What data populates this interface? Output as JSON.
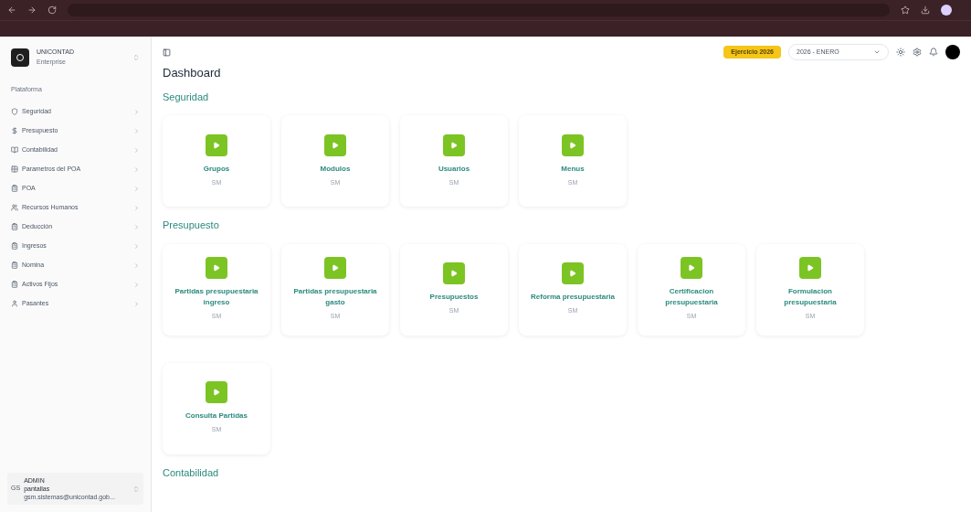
{
  "app": {
    "name": "UNICONTAD",
    "subtitle": "Enterprise"
  },
  "sidebar": {
    "group_label": "Plataforma",
    "items": [
      {
        "label": "Seguridad"
      },
      {
        "label": "Presupuesto"
      },
      {
        "label": "Contabilidad"
      },
      {
        "label": "Parametros del POA"
      },
      {
        "label": "POA"
      },
      {
        "label": "Recursos Humanos"
      },
      {
        "label": "Deducción"
      },
      {
        "label": "Ingresos"
      },
      {
        "label": "Nomina"
      },
      {
        "label": "Activos Fijos"
      },
      {
        "label": "Pasantes"
      }
    ]
  },
  "user": {
    "initials": "GS",
    "name": "ADMIN",
    "role": "pantallas",
    "email": "gsm.sistemas@unicontad.gob..."
  },
  "header": {
    "fiscal_year": "Ejercicio 2026",
    "period": "2026 - ENERO"
  },
  "page_title": "Dashboard",
  "sections": [
    {
      "title": "Seguridad",
      "cards": [
        {
          "label": "Grupos",
          "sub": "SM"
        },
        {
          "label": "Modulos",
          "sub": "SM"
        },
        {
          "label": "Usuarios",
          "sub": "SM"
        },
        {
          "label": "Menus",
          "sub": "SM"
        }
      ]
    },
    {
      "title": "Presupuesto",
      "cards": [
        {
          "label": "Partidas presupuestaria ingreso",
          "sub": "SM"
        },
        {
          "label": "Partidas presupuestaria gasto",
          "sub": "SM"
        },
        {
          "label": "Presupuestos",
          "sub": "SM"
        },
        {
          "label": "Reforma presupuestaria",
          "sub": "SM"
        },
        {
          "label": "Certificacion presupuestaria",
          "sub": "SM"
        },
        {
          "label": "Formulacion presupuestaria",
          "sub": "SM"
        },
        {
          "label": "Consulta Partidas",
          "sub": "SM"
        }
      ]
    },
    {
      "title": "Contabilidad"
    }
  ]
}
